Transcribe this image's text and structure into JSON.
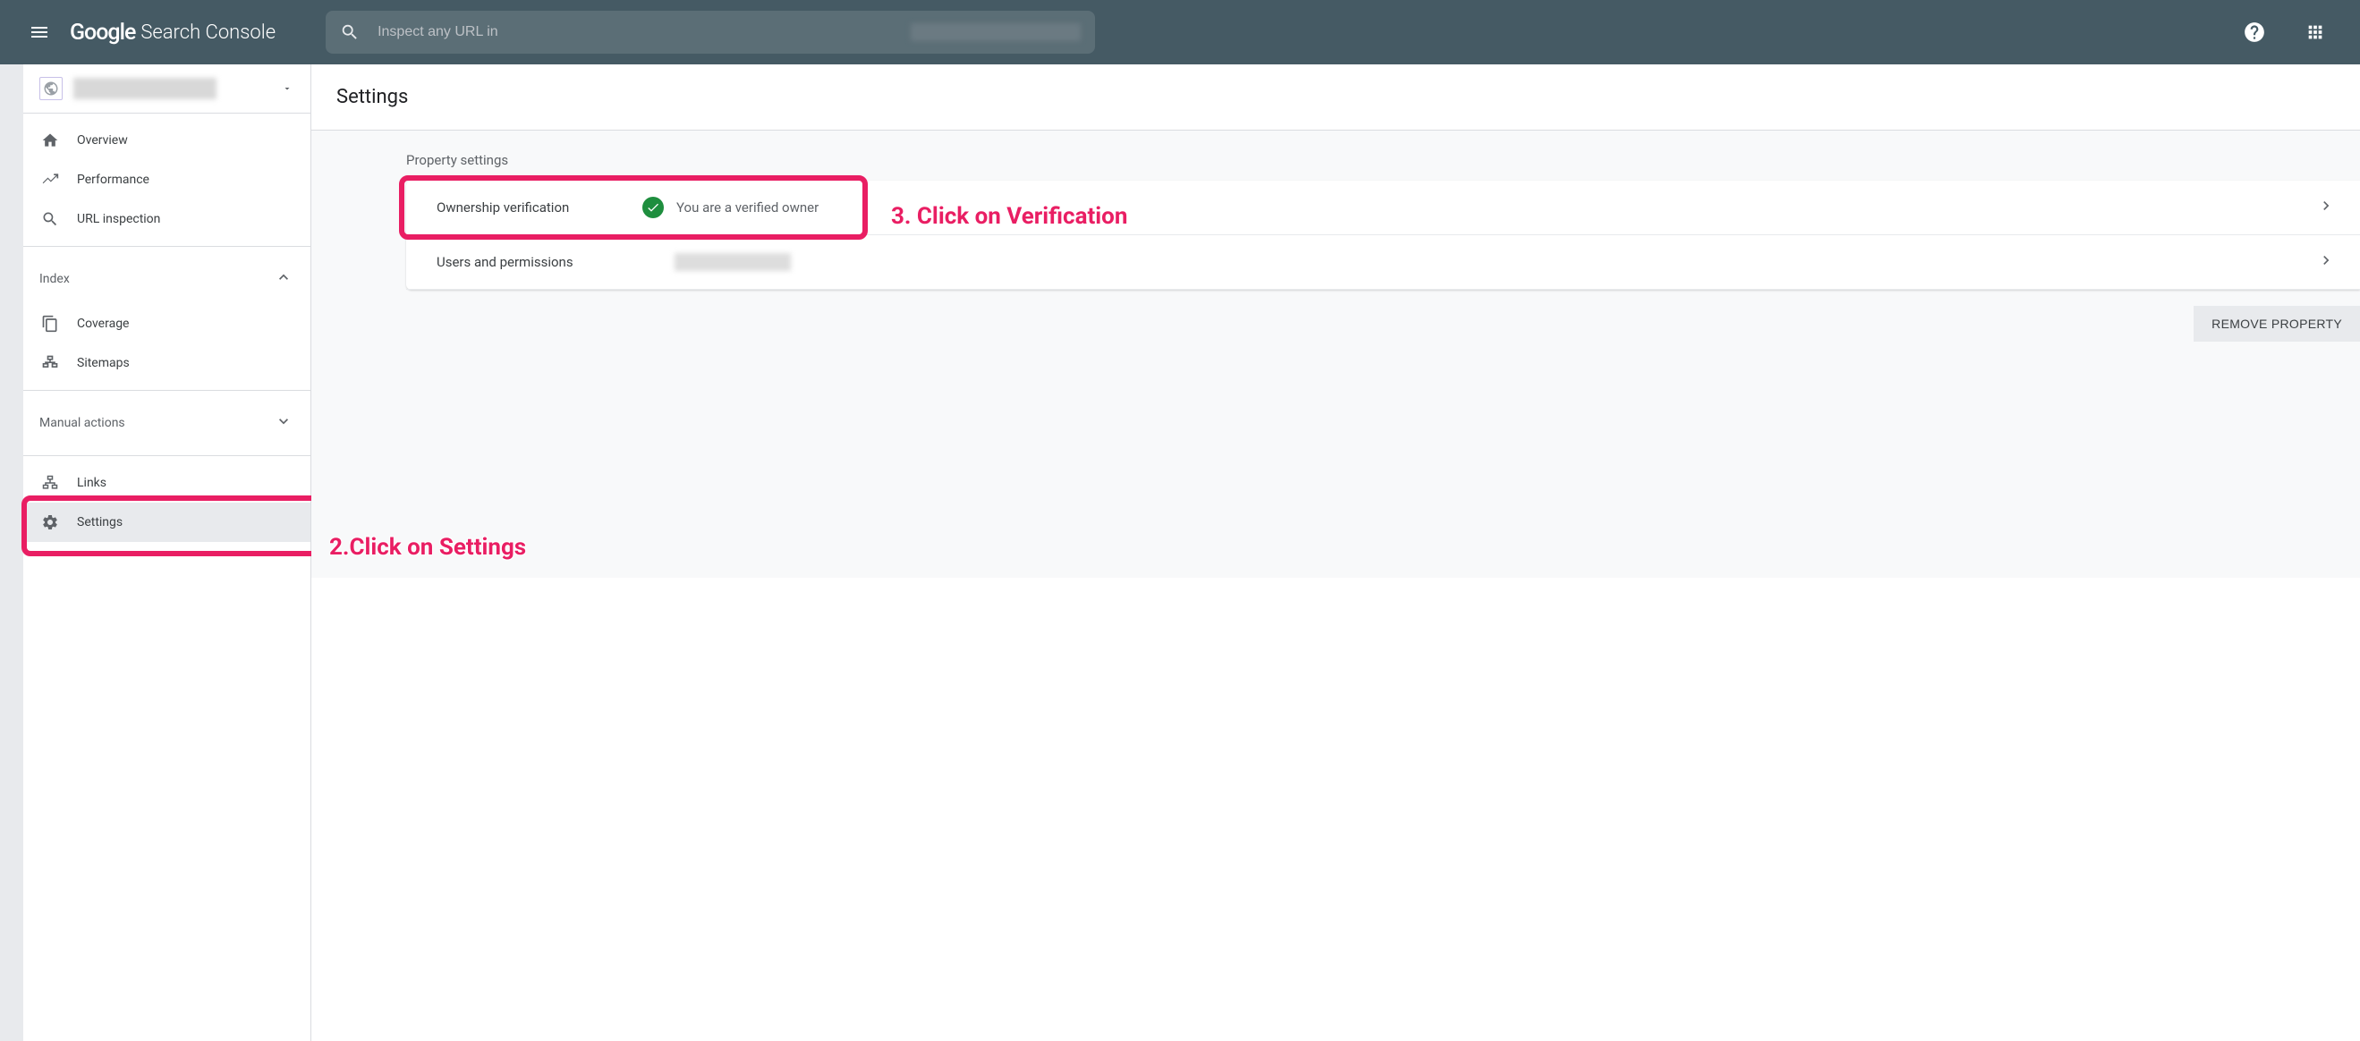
{
  "header": {
    "logo_google": "Google",
    "logo_product": "Search Console",
    "search_placeholder": "Inspect any URL in"
  },
  "sidebar": {
    "overview": "Overview",
    "performance": "Performance",
    "url_inspection": "URL inspection",
    "index_header": "Index",
    "coverage": "Coverage",
    "sitemaps": "Sitemaps",
    "manual_actions_header": "Manual actions",
    "links": "Links",
    "settings": "Settings"
  },
  "main": {
    "title": "Settings",
    "section_label": "Property settings",
    "ownership_label": "Ownership verification",
    "ownership_status": "You are a verified owner",
    "users_label": "Users and permissions",
    "remove_button": "REMOVE PROPERTY"
  },
  "annotations": {
    "settings": "2.Click on Settings",
    "verification": "3. Click on Verification"
  }
}
